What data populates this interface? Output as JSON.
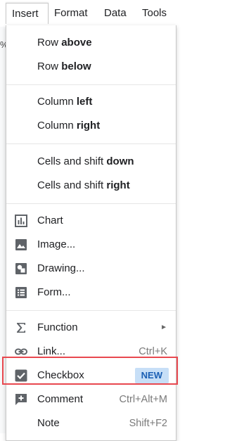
{
  "menubar": {
    "items": [
      {
        "label": "Insert"
      },
      {
        "label": "Format"
      },
      {
        "label": "Data"
      },
      {
        "label": "Tools"
      }
    ]
  },
  "background": {
    "glyph": "%"
  },
  "insert_menu": {
    "row_above": {
      "prefix": "Row",
      "bold": "above"
    },
    "row_below": {
      "prefix": "Row",
      "bold": "below"
    },
    "column_left": {
      "prefix": "Column",
      "bold": "left"
    },
    "column_right": {
      "prefix": "Column",
      "bold": "right"
    },
    "cells_shift_down": {
      "prefix": "Cells and shift",
      "bold": "down"
    },
    "cells_shift_right": {
      "prefix": "Cells and shift",
      "bold": "right"
    },
    "chart": {
      "label": "Chart"
    },
    "image": {
      "label": "Image..."
    },
    "drawing": {
      "label": "Drawing..."
    },
    "form": {
      "label": "Form..."
    },
    "function": {
      "label": "Function",
      "arrow": "►"
    },
    "link": {
      "label": "Link...",
      "shortcut": "Ctrl+K"
    },
    "checkbox": {
      "label": "Checkbox",
      "badge": "NEW"
    },
    "comment": {
      "label": "Comment",
      "shortcut": "Ctrl+Alt+M"
    },
    "note": {
      "label": "Note",
      "shortcut": "Shift+F2"
    }
  },
  "colors": {
    "highlight_border": "#e8484f",
    "badge_bg": "#c7dff7",
    "badge_text": "#1a5fb4",
    "icon_gray": "#5f6368"
  }
}
